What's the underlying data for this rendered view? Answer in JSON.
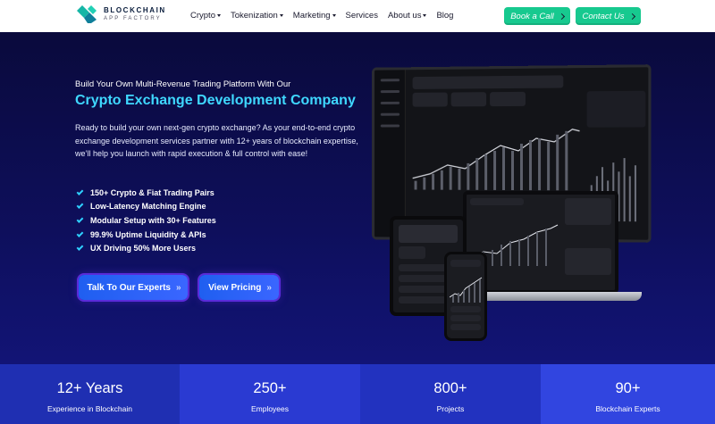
{
  "logo": {
    "line1": "BLOCKCHAIN",
    "line2": "APP FACTORY"
  },
  "nav": {
    "items": [
      {
        "label": "Crypto",
        "dropdown": true
      },
      {
        "label": "Tokenization",
        "dropdown": true
      },
      {
        "label": "Marketing",
        "dropdown": true
      },
      {
        "label": "Services",
        "dropdown": false
      },
      {
        "label": "About us",
        "dropdown": true
      },
      {
        "label": "Blog",
        "dropdown": false
      }
    ]
  },
  "header_buttons": {
    "book": "Book a Call",
    "contact": "Contact Us"
  },
  "hero": {
    "subtitle": "Build Your Own Multi-Revenue Trading Platform With Our",
    "title": "Crypto Exchange Development Company",
    "description": "Ready to build your own next-gen crypto exchange? As your end-to-end crypto exchange development services partner with 12+ years of blockchain expertise, we’ll help you launch with rapid execution & full control with ease!",
    "features": [
      "150+ Crypto & Fiat Trading Pairs",
      "Low-Latency Matching Engine",
      "Modular Setup with 30+ Features",
      "99.9% Uptime Liquidity & APIs",
      "UX Driving 50% More Users"
    ],
    "cta_primary": "Talk To Our Experts",
    "cta_secondary": "View Pricing",
    "cta_arrows": "»"
  },
  "stats": [
    {
      "value": "12+ Years",
      "label": "Experience in Blockchain",
      "bg": "#1f2fb2"
    },
    {
      "value": "250+",
      "label": "Employees",
      "bg": "#2a3ad2"
    },
    {
      "value": "800+",
      "label": "Projects",
      "bg": "#2232bf"
    },
    {
      "value": "90+",
      "label": "Blockchain Experts",
      "bg": "#3145e0"
    }
  ],
  "colors": {
    "accent": "#17c98f",
    "title": "#3fd8ff",
    "cta": "#2a5ff5"
  }
}
